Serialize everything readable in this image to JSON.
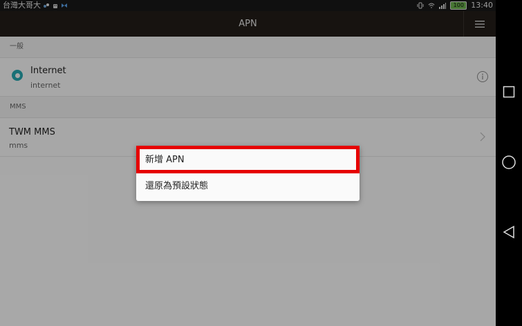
{
  "status_bar": {
    "carrier": "台灣大哥大",
    "time": "13:40",
    "battery_level": "100",
    "icons": [
      "notification-icon",
      "android-icon",
      "app-icon",
      "vibrate-icon",
      "wifi-icon",
      "signal-icon",
      "battery-icon"
    ]
  },
  "toolbar": {
    "title": "APN",
    "menu_icon": "menu-icon"
  },
  "sections": [
    {
      "header": "一般",
      "items": [
        {
          "name": "Internet",
          "apn": "internet",
          "selected": true,
          "trailing_icon": "info-icon"
        }
      ]
    },
    {
      "header": "MMS",
      "items": [
        {
          "name": "TWM MMS",
          "apn": "mms",
          "selected": false,
          "trailing_icon": "chevron-right-icon"
        }
      ]
    }
  ],
  "dialog": {
    "items": [
      {
        "label": "新增 APN",
        "highlighted": true
      },
      {
        "label": "還原為預設狀態",
        "highlighted": false
      }
    ]
  },
  "nav_bar": {
    "icons": [
      "recents-icon",
      "home-icon",
      "back-icon"
    ]
  },
  "colors": {
    "accent": "#28a7b0",
    "toolbar_bg": "#231d19",
    "highlight_border": "#e60000"
  }
}
